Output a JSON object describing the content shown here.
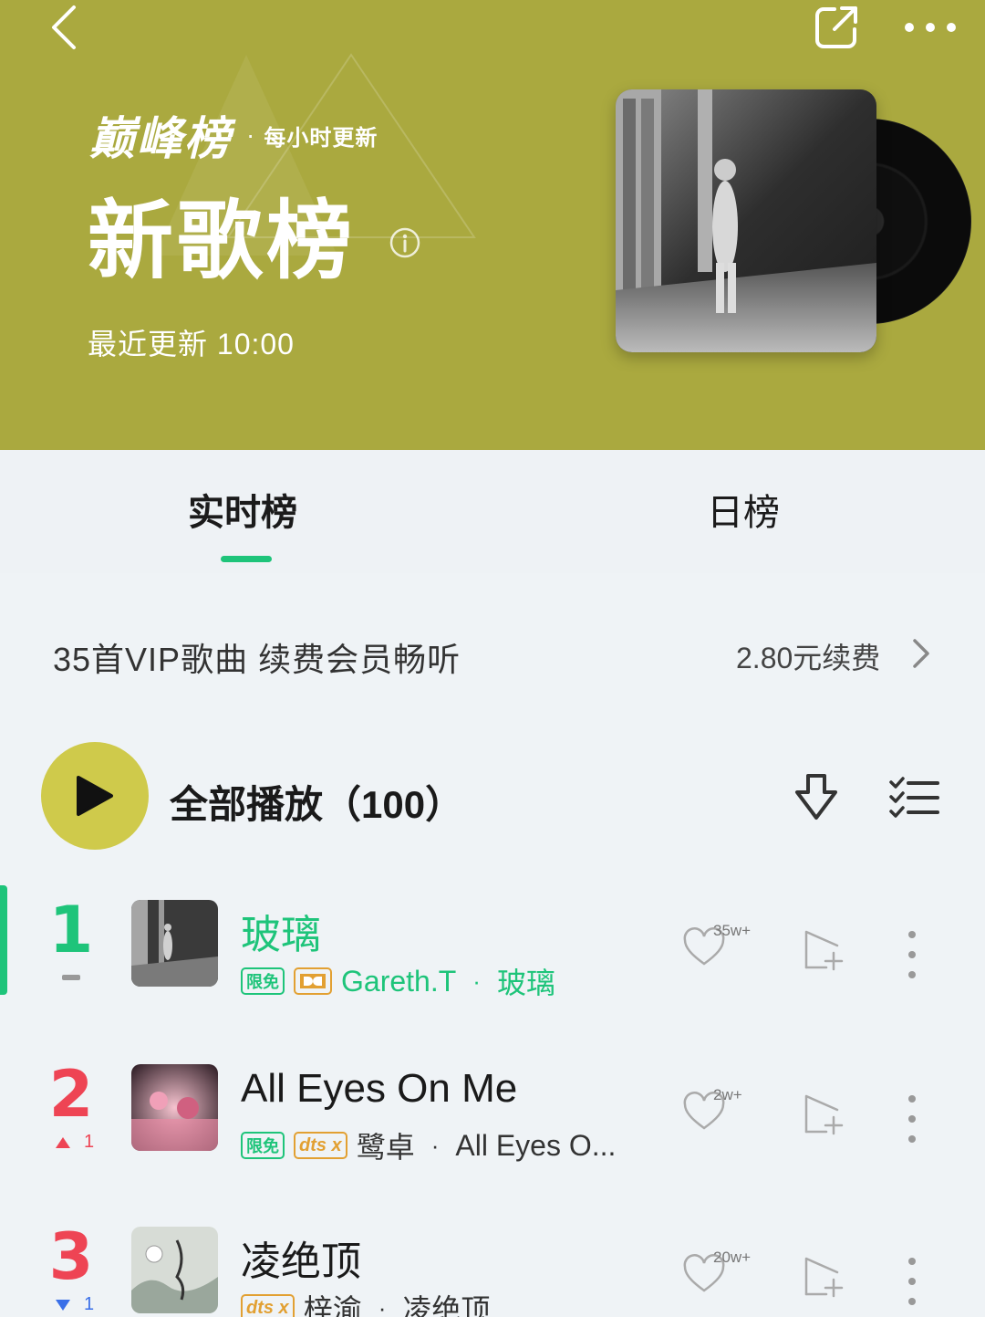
{
  "header": {
    "brand": "巅峰榜",
    "brand_dot": "·",
    "brand_sub": "每小时更新",
    "title": "新歌榜",
    "updated": "最近更新 10:00",
    "bg_color": "#aaa93f"
  },
  "icons": {
    "back": "back-arrow-icon",
    "share": "share-icon",
    "more": "more-icon",
    "info": "info-icon",
    "play": "play-icon",
    "download": "download-icon",
    "multi_select": "multi-select-icon",
    "chevron": "chevron-right-icon",
    "like": "heart-icon",
    "add": "add-to-playlist-icon",
    "song_more": "vertical-dots-icon"
  },
  "tabs": [
    {
      "label": "实时榜",
      "active": true
    },
    {
      "label": "日榜",
      "active": false
    }
  ],
  "vip": {
    "text": "35首VIP歌曲 续费会员畅听",
    "renew": "2.80元续费"
  },
  "play_all": {
    "label": "全部播放（100）"
  },
  "songs": [
    {
      "rank": "1",
      "title": "玻璃",
      "badge_free": "限免",
      "artist": "Gareth.T",
      "sep": "·",
      "album": "玻璃",
      "likes": "35w+"
    },
    {
      "rank": "2",
      "change": "1",
      "title": "All Eyes On Me",
      "badge_free": "限免",
      "badge_dts": "dts x",
      "artist": "鹭卓",
      "sep": "·",
      "album": "All Eyes O...",
      "likes": "2w+"
    },
    {
      "rank": "3",
      "change": "1",
      "title": "凌绝顶",
      "badge_dts": "dts x",
      "artist": "梓渝",
      "sep": "·",
      "album": "凌绝顶",
      "likes": "20w+"
    }
  ],
  "colors": {
    "accent_green": "#1ec47a",
    "rank_red": "#ee4454",
    "play_yellow": "#cfca4b",
    "badge_gold": "#e2a032"
  }
}
